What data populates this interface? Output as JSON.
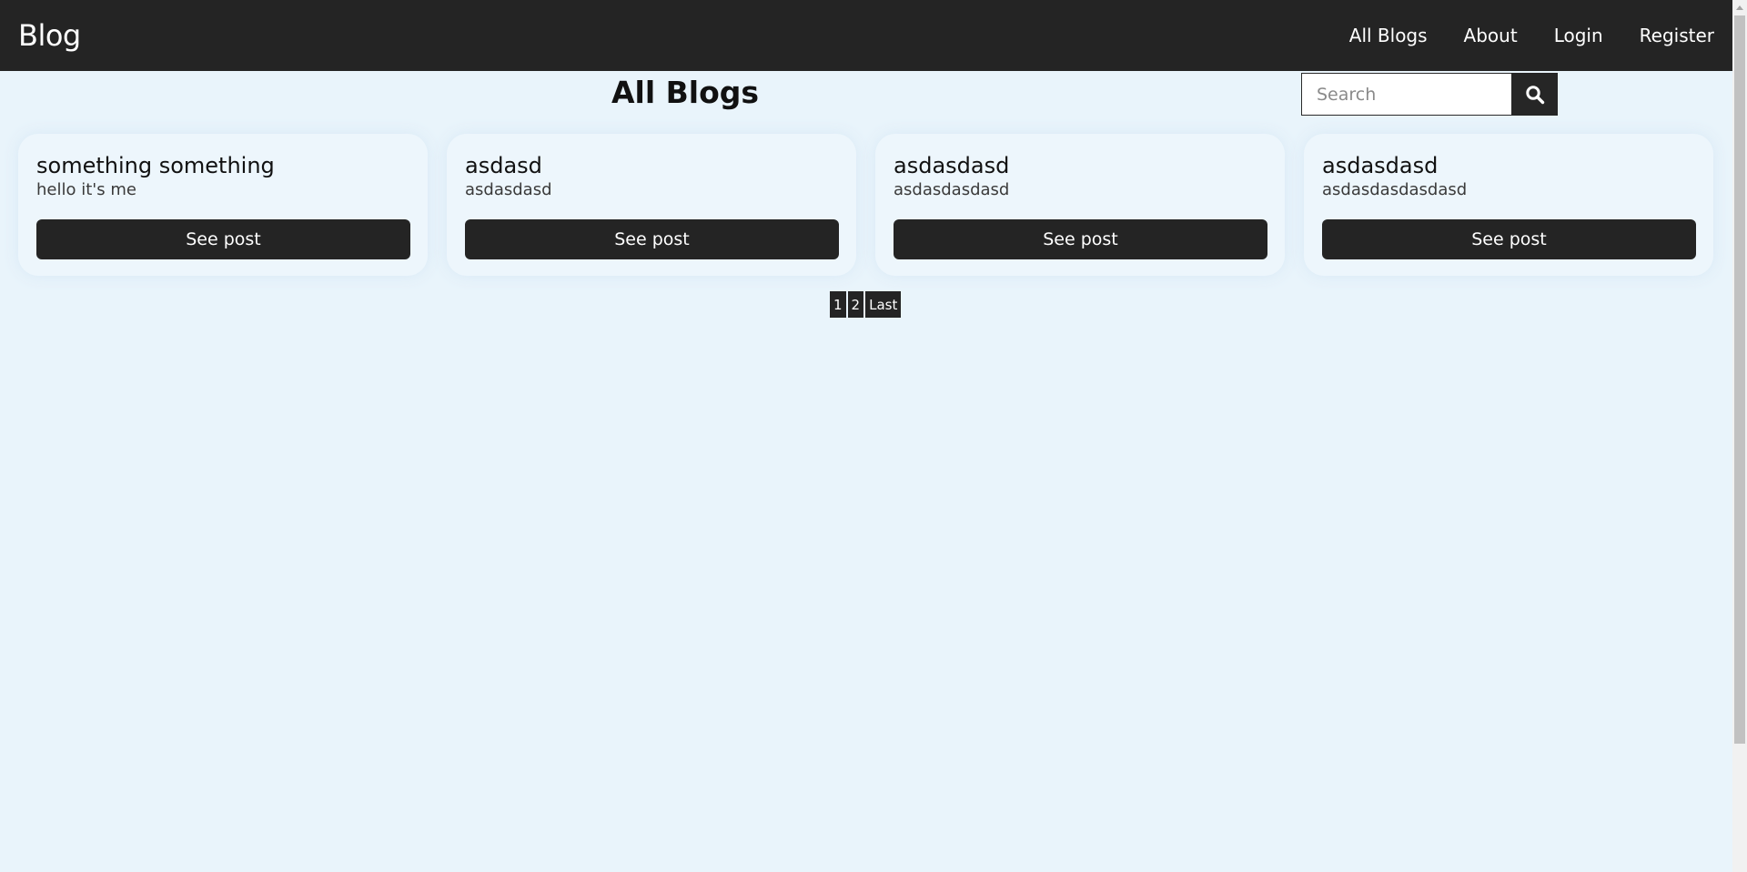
{
  "navbar": {
    "brand": "Blog",
    "links": [
      "All Blogs",
      "About",
      "Login",
      "Register"
    ]
  },
  "main": {
    "title": "All Blogs",
    "search": {
      "placeholder": "Search",
      "value": ""
    }
  },
  "posts": [
    {
      "title": "something something",
      "excerpt": "hello it's me",
      "button": "See post"
    },
    {
      "title": "asdasd",
      "excerpt": "asdasdasd",
      "button": "See post"
    },
    {
      "title": "asdasdasd",
      "excerpt": "asdasdasdasd",
      "button": "See post"
    },
    {
      "title": "asdasdasd",
      "excerpt": "asdasdasdasdasd",
      "button": "See post"
    }
  ],
  "pagination": [
    "1",
    "2",
    "Last"
  ],
  "colors": {
    "navbar": "#242424",
    "background": "#e9f4fb",
    "card": "#edf6fc",
    "button": "#242424"
  },
  "icons": {
    "search": "search-icon"
  }
}
